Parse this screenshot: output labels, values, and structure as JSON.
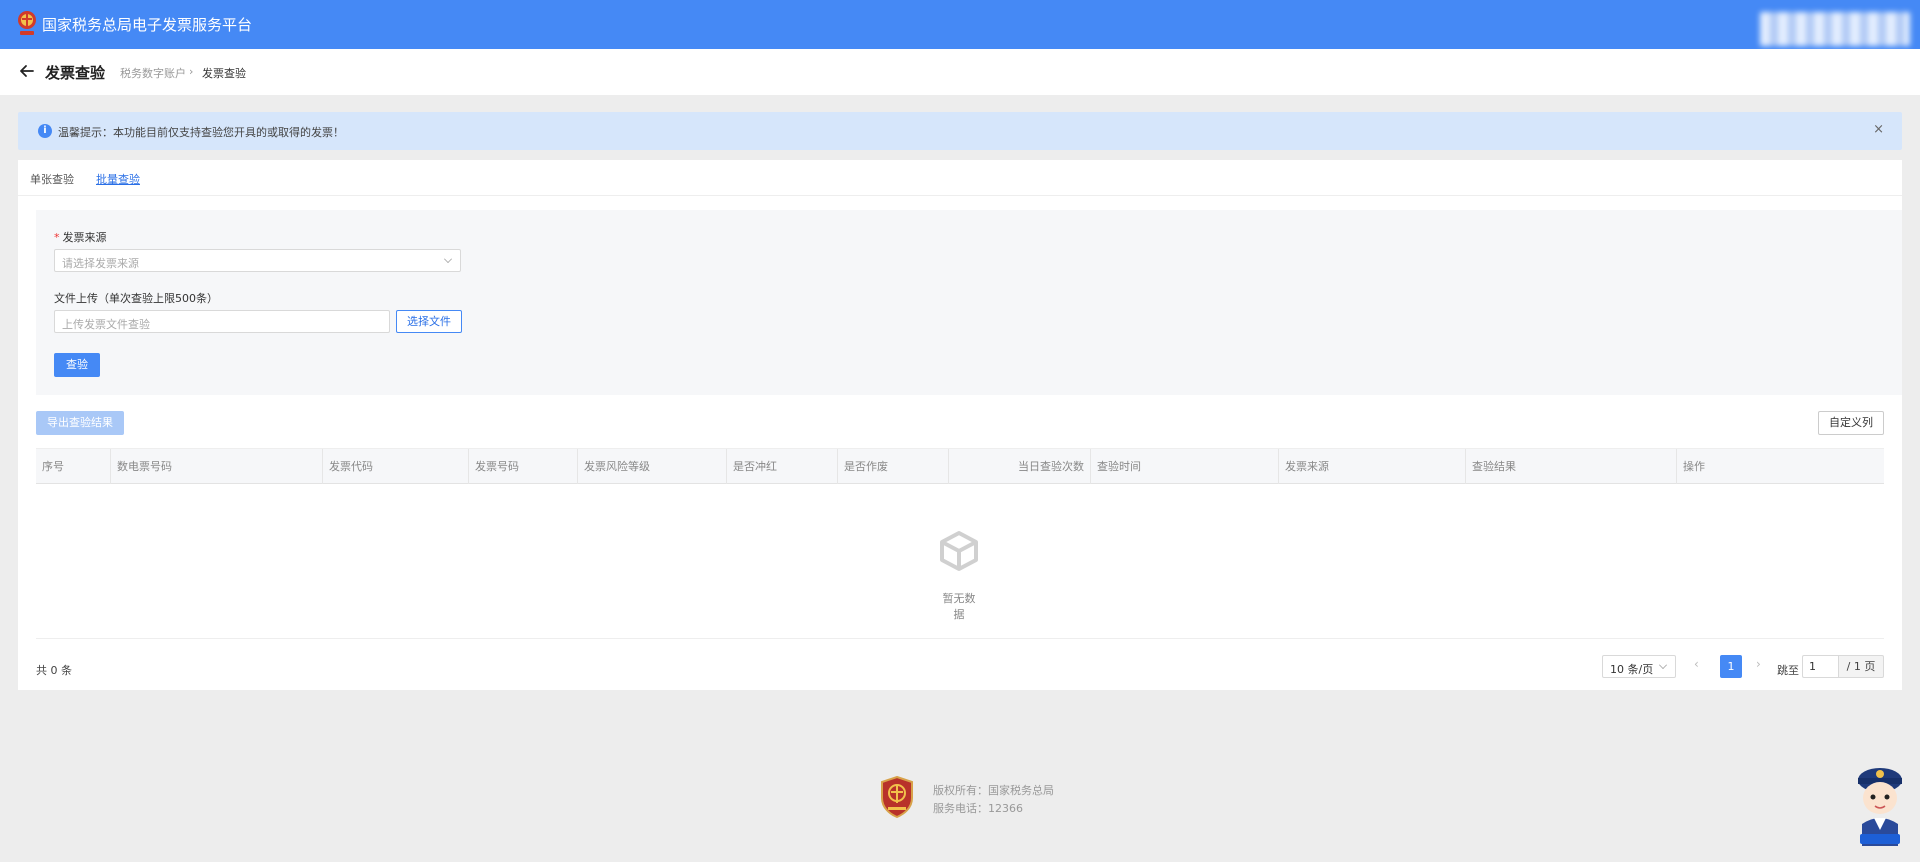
{
  "header": {
    "title": "国家税务总局电子发票服务平台"
  },
  "breadcrumb": {
    "page_title": "发票查验",
    "items": [
      "税务数字账户",
      "发票查验"
    ],
    "separator": "›"
  },
  "notice": {
    "text": "温馨提示：本功能目前仅支持查验您开具的或取得的发票！",
    "close": "×"
  },
  "tabs": [
    {
      "label": "单张查验",
      "active": false
    },
    {
      "label": "批量查验",
      "active": true
    }
  ],
  "form": {
    "source_label": "发票来源",
    "required_mark": "*",
    "source_placeholder": "请选择发票来源",
    "upload_label": "文件上传（单次查验上限500条）",
    "upload_placeholder": "上传发票文件查验",
    "choose_file_label": "选择文件",
    "check_label": "查验"
  },
  "toolbar": {
    "export_label": "导出查验结果",
    "custom_columns_label": "自定义列"
  },
  "table": {
    "columns": [
      "序号",
      "数电票号码",
      "发票代码",
      "发票号码",
      "发票风险等级",
      "是否冲红",
      "是否作废",
      "当日查验次数",
      "查验时间",
      "发票来源",
      "查验结果",
      "操作"
    ],
    "empty_text": "暂无数据"
  },
  "pagination": {
    "total": "共 0 条",
    "page_size": "10 条/页",
    "current_page": "1",
    "jump_label": "跳至",
    "jump_value": "1",
    "total_pages": "/ 1 页"
  },
  "footer": {
    "copyright": "版权所有：国家税务总局",
    "hotline": "服务电话：12366"
  },
  "colors": {
    "primary": "#4589f5",
    "notice_bg": "#d6e6fb",
    "page_bg": "#ededed"
  }
}
